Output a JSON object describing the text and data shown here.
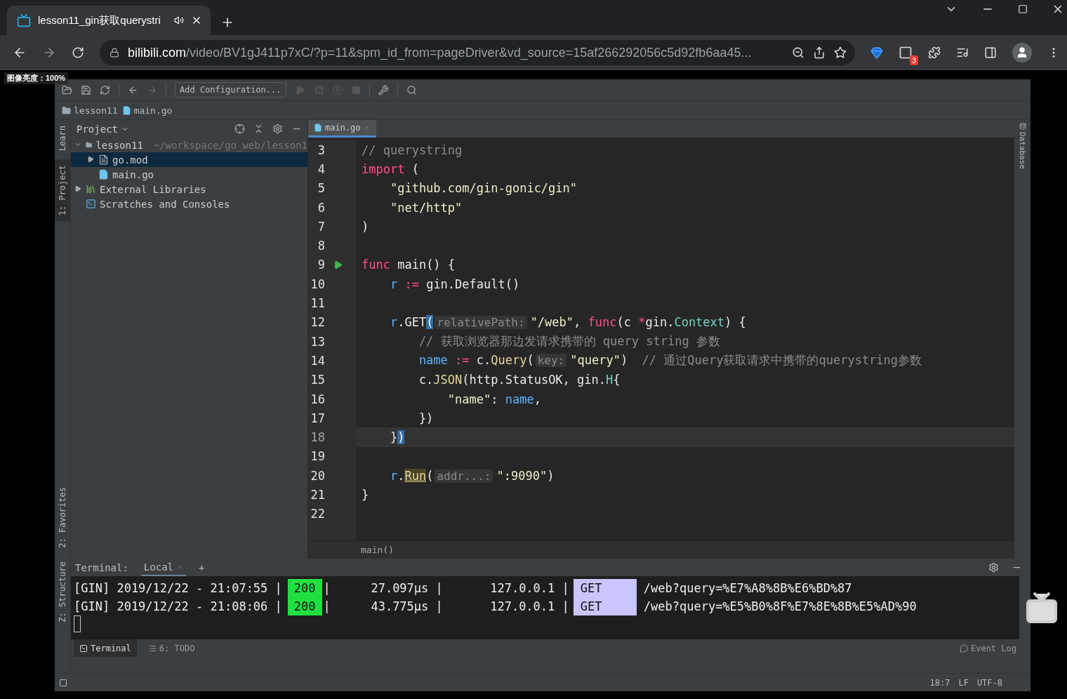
{
  "browser": {
    "tab": {
      "title": "lesson11_gin获取querystri",
      "selected": true
    },
    "address": {
      "domain": "bilibili.com",
      "rest": "/video/BV1gJ411p7xC/?p=11&spm_id_from=pageDriver&vd_source=15af266292056c5d92fb6aa45..."
    },
    "extension_badge": "3"
  },
  "overlay_label": "图像亮度：100%",
  "ide": {
    "toolbar": {
      "run_config": "Add Configuration..."
    },
    "breadcrumbs": [
      "lesson11",
      "main.go"
    ],
    "left_strip": {
      "top": [
        {
          "label": "Learn",
          "selected": false
        },
        {
          "label": "1: Project",
          "selected": true
        }
      ],
      "bottom": [
        {
          "label": "2: Favorites",
          "selected": false
        },
        {
          "label": "Z: Structure",
          "selected": false
        }
      ]
    },
    "right_strip": [
      "Database"
    ],
    "project": {
      "title": "Project",
      "tree": [
        {
          "label": "lesson11",
          "path": "~/workspace/go_web/lesson1",
          "kind": "folder",
          "expanded": true,
          "selected": false,
          "children": [
            {
              "label": "go.mod",
              "kind": "text-file",
              "expanded": false,
              "selected": true
            },
            {
              "label": "main.go",
              "kind": "go-file",
              "selected": false
            }
          ]
        },
        {
          "label": "External Libraries",
          "kind": "libraries",
          "expanded": false,
          "selected": false
        },
        {
          "label": "Scratches and Consoles",
          "kind": "scratches",
          "selected": false
        }
      ]
    },
    "editor": {
      "tabs": [
        {
          "label": "main.go",
          "selected": true
        }
      ],
      "lines": [
        {
          "number": "3",
          "current": false,
          "runnable": false,
          "tokens": [
            {
              "text": "// querystring",
              "kind": "comment"
            }
          ]
        },
        {
          "number": "4",
          "current": false,
          "runnable": false,
          "tokens": [
            {
              "text": "import",
              "kind": "keyword"
            },
            {
              "text": " (",
              "kind": "plain"
            }
          ]
        },
        {
          "number": "5",
          "current": false,
          "runnable": false,
          "tokens": [
            {
              "text": "    \"github.com/gin-gonic/gin\"",
              "kind": "string"
            }
          ]
        },
        {
          "number": "6",
          "current": false,
          "runnable": false,
          "tokens": [
            {
              "text": "    \"net/http\"",
              "kind": "string"
            }
          ]
        },
        {
          "number": "7",
          "current": false,
          "runnable": false,
          "tokens": [
            {
              "text": ")",
              "kind": "plain"
            }
          ]
        },
        {
          "number": "8",
          "current": false,
          "runnable": false
        },
        {
          "number": "9",
          "current": false,
          "runnable": true,
          "tokens": [
            {
              "text": "func",
              "kind": "keyword"
            },
            {
              "text": " main() {",
              "kind": "plain"
            }
          ]
        },
        {
          "number": "10",
          "current": false,
          "runnable": false,
          "tokens": [
            {
              "text": "    r",
              "kind": "variable"
            },
            {
              "text": " :=",
              "kind": "operator"
            },
            {
              "text": " gin.Default()",
              "kind": "plain"
            }
          ]
        },
        {
          "number": "11",
          "current": false,
          "runnable": false
        },
        {
          "number": "12",
          "current": false,
          "runnable": false,
          "tokens": [
            {
              "text": "    r",
              "kind": "variable"
            },
            {
              "text": ".GET",
              "kind": "plain"
            },
            {
              "text": "(",
              "kind": "match"
            },
            {
              "text": "relativePath:",
              "kind": "hint"
            },
            {
              "text": "\"/web\"",
              "kind": "string"
            },
            {
              "text": ", ",
              "kind": "plain"
            },
            {
              "text": "func",
              "kind": "keyword"
            },
            {
              "text": "(c ",
              "kind": "plain"
            },
            {
              "text": "*",
              "kind": "operator"
            },
            {
              "text": "gin.",
              "kind": "plain"
            },
            {
              "text": "Context",
              "kind": "type"
            },
            {
              "text": ") {",
              "kind": "plain"
            }
          ]
        },
        {
          "number": "13",
          "current": false,
          "runnable": false,
          "tokens": [
            {
              "text": "        // 获取浏览器那边发请求携带的 query string 参数",
              "kind": "comment"
            }
          ]
        },
        {
          "number": "14",
          "current": false,
          "runnable": false,
          "tokens": [
            {
              "text": "        name",
              "kind": "variable"
            },
            {
              "text": " :=",
              "kind": "operator"
            },
            {
              "text": " c.",
              "kind": "plain"
            },
            {
              "text": "Query",
              "kind": "function"
            },
            {
              "text": "(",
              "kind": "plain"
            },
            {
              "text": "key:",
              "kind": "hint"
            },
            {
              "text": "\"query\"",
              "kind": "string"
            },
            {
              "text": ")  ",
              "kind": "plain"
            },
            {
              "text": "// 通过Query获取请求中携带的querystring参数",
              "kind": "comment"
            }
          ]
        },
        {
          "number": "15",
          "current": false,
          "runnable": false,
          "tokens": [
            {
              "text": "        c.",
              "kind": "plain"
            },
            {
              "text": "JSON",
              "kind": "function"
            },
            {
              "text": "(http.StatusOK, gin.",
              "kind": "plain"
            },
            {
              "text": "H",
              "kind": "type"
            },
            {
              "text": "{",
              "kind": "plain"
            }
          ]
        },
        {
          "number": "16",
          "current": false,
          "runnable": false,
          "tokens": [
            {
              "text": "            \"name\"",
              "kind": "string"
            },
            {
              "text": ": ",
              "kind": "plain"
            },
            {
              "text": "name",
              "kind": "variable"
            },
            {
              "text": ",",
              "kind": "plain"
            }
          ]
        },
        {
          "number": "17",
          "current": false,
          "runnable": false,
          "tokens": [
            {
              "text": "        })",
              "kind": "plain"
            }
          ]
        },
        {
          "number": "18",
          "current": true,
          "runnable": false,
          "tokens": [
            {
              "text": "    }",
              "kind": "plain"
            },
            {
              "text": ")",
              "kind": "match"
            }
          ]
        },
        {
          "number": "19",
          "current": false,
          "runnable": false
        },
        {
          "number": "20",
          "current": false,
          "runnable": false,
          "tokens": [
            {
              "text": "    r",
              "kind": "variable"
            },
            {
              "text": ".",
              "kind": "plain"
            },
            {
              "text": "Run",
              "kind": "usage"
            },
            {
              "text": "(",
              "kind": "plain"
            },
            {
              "text": "addr...:",
              "kind": "hint"
            },
            {
              "text": "\":9090\"",
              "kind": "string"
            },
            {
              "text": ")",
              "kind": "plain"
            }
          ]
        },
        {
          "number": "21",
          "current": false,
          "runnable": false,
          "tokens": [
            {
              "text": "}",
              "kind": "plain"
            }
          ]
        },
        {
          "number": "22",
          "current": false,
          "runnable": false
        }
      ],
      "breadcrumb": "main()"
    },
    "terminal": {
      "title": "Terminal:",
      "tabs": [
        {
          "label": "Local",
          "selected": true
        }
      ],
      "add": "+",
      "rows": [
        {
          "prefix": "[GIN] 2019/12/22 - 21:07:55 |",
          "status": "200",
          "sep": "|",
          "latency": "27.097µs |",
          "ip": "127.0.0.1 |",
          "method": "GET",
          "path": "/web?query=%E7%A8%8B%E6%BD%87"
        },
        {
          "prefix": "[GIN] 2019/12/22 - 21:08:06 |",
          "status": "200",
          "sep": "|",
          "latency": "43.775µs |",
          "ip": "127.0.0.1 |",
          "method": "GET",
          "path": "/web?query=%E5%B0%8F%E7%8E%8B%E5%AD%90"
        }
      ]
    },
    "tool_tabs": [
      {
        "label": "Terminal",
        "kind": "terminal",
        "selected": true
      },
      {
        "label": "6: TODO",
        "kind": "todo",
        "selected": false
      }
    ],
    "event_log": "Event Log",
    "status_bar": [
      "18:7",
      "LF",
      "UTF-8"
    ]
  }
}
